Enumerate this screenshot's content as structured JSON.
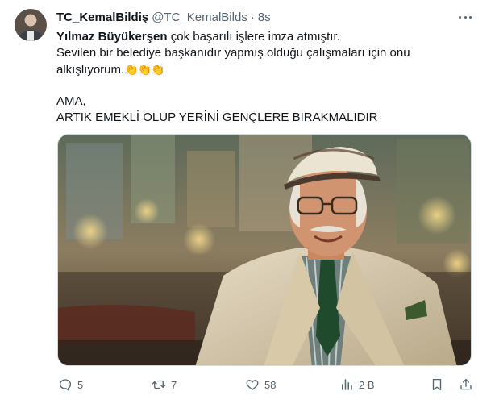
{
  "tweet": {
    "author_name": "TC_KemalBildiş",
    "author_handle": "@TC_KemalBilds",
    "separator": "·",
    "time": "8s",
    "text": {
      "line1_bold": "Yılmaz Büyükerşen",
      "line1_rest": " çok başarılı işlere imza atmıştır.",
      "line2": "Sevilen bir belediye başkanıdır yapmış olduğu çalışmaları için onu",
      "line3": "alkışlıyorum.",
      "line3_emoji": "👏👏👏",
      "line4": "AMA,",
      "line5": "ARTIK EMEKLİ OLUP YERİNİ GENÇLERE BIRAKMALIDIR"
    },
    "actions": {
      "replies": "5",
      "reposts": "7",
      "likes": "58",
      "views": "2 B"
    }
  },
  "colors": {
    "text_primary": "#0f1419",
    "text_secondary": "#536471",
    "border": "#cfd9de"
  }
}
